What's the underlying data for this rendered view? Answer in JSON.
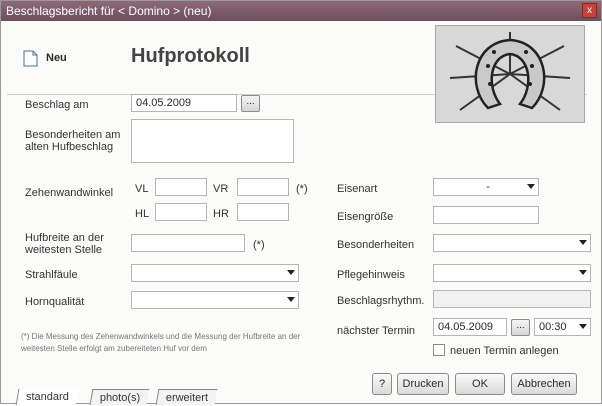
{
  "window": {
    "title": "Beschlagsbericht für < Domino > (neu)",
    "close_glyph": "x"
  },
  "header": {
    "new_label": "Neu",
    "title": "Hufprotokoll",
    "logo_icon": "horseshoe-icon"
  },
  "form": {
    "beschlag_am_label": "Beschlag am",
    "beschlag_am_value": "04.05.2009",
    "date_picker_label": "...",
    "besonderheiten_alt_label": "Besonderheiten am alten Hufbeschlag",
    "zehenwandwinkel_label": "Zehenwandwinkel",
    "vl_label": "VL",
    "vr_label": "VR",
    "hl_label": "HL",
    "hr_label": "HR",
    "star_marker": "(*)",
    "hufbreite_label": "Hufbreite an der weitesten Stelle",
    "hufbreite_star": "(*)",
    "strahlfaeule_label": "Strahlfäule",
    "hornqualitaet_label": "Hornqualität",
    "eisenart_label": "Eisenart",
    "eisenart_value": "-",
    "eisengroesse_label": "Eisengröße",
    "besonderheiten_label": "Besonderheiten",
    "pflegehinweis_label": "Pflegehinweis",
    "beschlagsrhythm_label": "Beschlagsrhythm.",
    "naechster_termin_label": "nächster Termin",
    "naechster_termin_value": "04.05.2009",
    "termin_picker_label": "...",
    "termin_time": "00:30",
    "neuer_termin_label": "neuen Termin anlegen",
    "note": "(*) Die Messung des Zehenwandwinkels und die Messung der Hufbreite an der weitesten Stelle erfolgt am zubereiteten Huf vor dem"
  },
  "buttons": {
    "help": "?",
    "print": "Drucken",
    "ok": "OK",
    "cancel": "Abbrechen"
  },
  "tabs": [
    "standard",
    "photo(s)",
    "erweitert"
  ]
}
